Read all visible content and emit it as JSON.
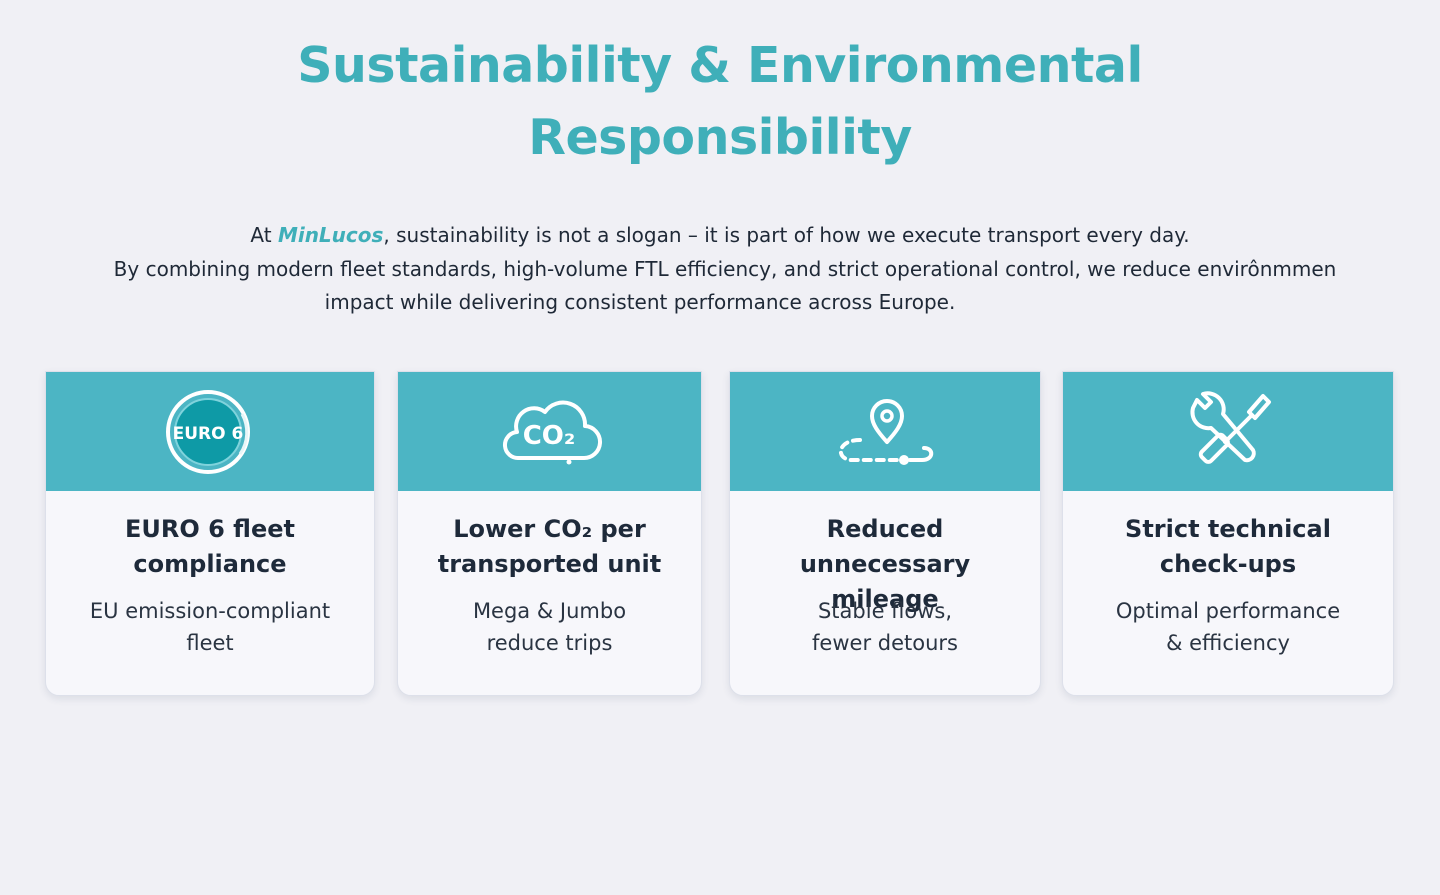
{
  "header": {
    "title_line1": "Sustainability & Environmental",
    "title_line2": "Responsibility"
  },
  "intro": {
    "line1_prefix": "At ",
    "brand": "MinLucos",
    "line1_suffix": ", sustainability is not a slogan – it is part of how we execute transport every day.",
    "line2": "By combining modern fleet standards, high-volume FTL efficiency, and strict operational control, we reduce envirônmmen",
    "line3": "impact while delivering consistent performance across Europe."
  },
  "cards": [
    {
      "icon": "euro6-badge-icon",
      "icon_text": "EURO 6",
      "title_line1": "EURO 6 fleet",
      "title_line2": "compliance",
      "sub_line1": "EU emission-compliant",
      "sub_line2": "fleet"
    },
    {
      "icon": "co2-cloud-icon",
      "icon_text": "CO₂",
      "title_line1": "Lower CO₂ per",
      "title_line2": "transported unit",
      "sub_line1": "Mega & Jumbo",
      "sub_line2": "reduce trips"
    },
    {
      "icon": "route-pin-icon",
      "title_line1": "Reduced",
      "title_line2": "unnecessary mileage",
      "sub_line1": "Stable flows,",
      "sub_line2": "fewer detours"
    },
    {
      "icon": "wrench-screwdriver-icon",
      "title_line1": "Strict technical",
      "title_line2": "check-ups",
      "sub_line1": "Optimal performance",
      "sub_line2": "& efficiency"
    }
  ],
  "colors": {
    "accent": "#3fafb9",
    "card_header": "#4cb5c4",
    "background": "#f0f0f5"
  }
}
